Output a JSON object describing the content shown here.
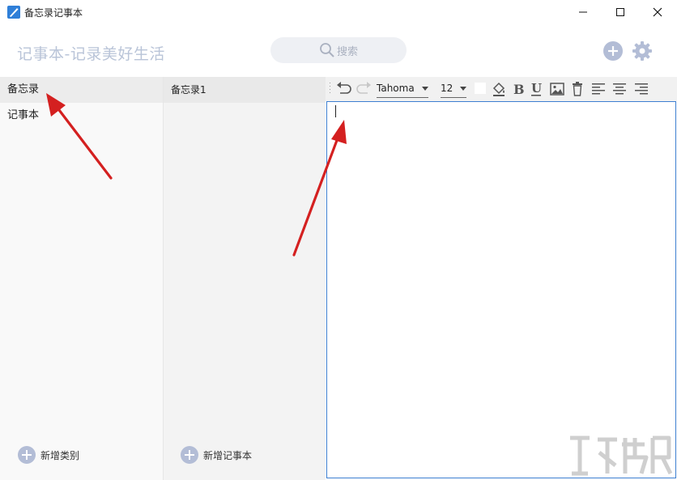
{
  "window": {
    "title": "备忘录记事本",
    "minimize_icon": "minimize-icon",
    "maximize_icon": "maximize-icon",
    "close_icon": "close-icon"
  },
  "header": {
    "app_heading": "记事本-记录美好生活",
    "search_placeholder": "搜索"
  },
  "categories": {
    "items": [
      {
        "label": "备忘录",
        "active": true
      },
      {
        "label": "记事本",
        "active": false
      }
    ],
    "add_label": "新增类别"
  },
  "notes": {
    "items": [
      {
        "label": "备忘录1"
      }
    ],
    "add_label": "新增记事本"
  },
  "toolbar": {
    "font": "Tahoma",
    "size": "12"
  },
  "colors": {
    "accent": "#3d7fd1",
    "icon_gray": "#b3bdd6",
    "arrow_red": "#d42020"
  }
}
